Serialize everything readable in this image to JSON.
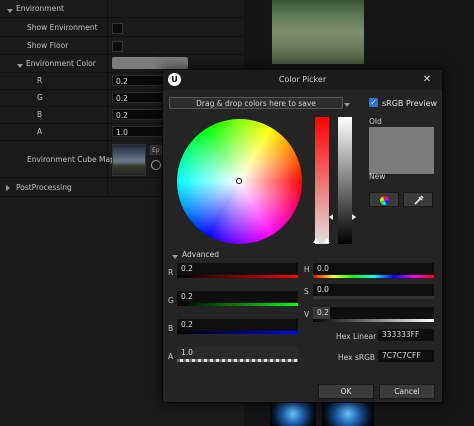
{
  "details": {
    "environment_label": "Environment",
    "show_environment_label": "Show Environment",
    "show_floor_label": "Show Floor",
    "env_color_label": "Environment Color",
    "r_label": "R",
    "r_value": "0.2",
    "g_label": "G",
    "g_value": "0.2",
    "b_label": "B",
    "b_value": "0.2",
    "a_label": "A",
    "a_value": "1.0",
    "cube_map_label": "Environment Cube Map",
    "postprocessing_label": "PostProcessing",
    "cube_btn_text": "Ep"
  },
  "dialog": {
    "title": "Color Picker",
    "close_glyph": "✕",
    "logo_glyph": "U",
    "drag_text": "Drag & drop colors here to save",
    "srgb_label": "sRGB Preview",
    "old_label": "Old",
    "new_label": "New",
    "advanced_label": "Advanced",
    "r_label": "R",
    "r_value": "0.2",
    "g_label": "G",
    "g_value": "0.2",
    "b_label": "B",
    "b_value": "0.2",
    "a_label": "A",
    "a_value": "1.0",
    "h_label": "H",
    "h_value": "0.0",
    "s_label": "S",
    "s_value": "0.0",
    "v_label": "V",
    "v_value": "0.2",
    "hex_linear_label": "Hex Linear",
    "hex_linear_value": "333333FF",
    "hex_srgb_label": "Hex sRGB",
    "hex_srgb_value": "7C7C7CFF",
    "ok_label": "OK",
    "cancel_label": "Cancel"
  },
  "colors": {
    "preview_gray": "#7c7c7c",
    "accent_blue": "#2a6fdb"
  }
}
